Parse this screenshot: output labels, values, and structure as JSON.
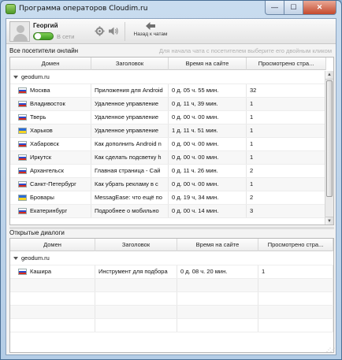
{
  "window": {
    "title": "Программа операторов Cloudim.ru",
    "minimize": "—",
    "maximize": "☐",
    "close": "✕"
  },
  "toolbar": {
    "operator_name": "Георгий",
    "status": "В сети",
    "back_label": "Назад к чатам"
  },
  "visitors": {
    "header": "Все посетители онлайн",
    "hint": "Для начала чата с посетителем выберите его двойным кликом",
    "columns": [
      "Домен",
      "Заголовок",
      "Время на сайте",
      "Просмотрено стра..."
    ],
    "group": "geodum.ru",
    "rows": [
      {
        "flag": "ru",
        "city": "Москва",
        "title": "Приложения для Android",
        "time": "0 д. 05 ч. 55 мин.",
        "views": "32"
      },
      {
        "flag": "ru",
        "city": "Владивосток",
        "title": "Удаленное управление",
        "time": "0 д. 11 ч, 39 мин.",
        "views": "1"
      },
      {
        "flag": "ru",
        "city": "Тверь",
        "title": "Удаленное управление",
        "time": "0 д. 00 ч. 00 мин.",
        "views": "1"
      },
      {
        "flag": "ua",
        "city": "Харьков",
        "title": "Удаленное управление",
        "time": "1 д. 11 ч. 51 мин.",
        "views": "1"
      },
      {
        "flag": "ru",
        "city": "Хабаровск",
        "title": "Как дополнить Android n",
        "time": "0 д. 00 ч. 00 мин.",
        "views": "1"
      },
      {
        "flag": "ru",
        "city": "Иркутск",
        "title": "Как сделать подсветку h",
        "time": "0 д. 00 ч. 00 мин.",
        "views": "1"
      },
      {
        "flag": "ru",
        "city": "Архангельск",
        "title": "Главная страница - Сай",
        "time": "0 д. 11 ч. 26 мин.",
        "views": "2"
      },
      {
        "flag": "ru",
        "city": "Санкт-Петербург",
        "title": "Как убрать рекламу в с",
        "time": "0 д. 00 ч. 00 мин.",
        "views": "1"
      },
      {
        "flag": "ua",
        "city": "Бровары",
        "title": "MessagEase: что ещё по",
        "time": "0 д. 19 ч, 34 мин.",
        "views": "2"
      },
      {
        "flag": "ru",
        "city": "Екатеринбург",
        "title": "Подробнее о мобильно",
        "time": "0 д. 00 ч. 14 мин.",
        "views": "3"
      }
    ]
  },
  "dialogs": {
    "header": "Открытые диалоги",
    "columns": [
      "Домен",
      "Заголовок",
      "Время на сайте",
      "Просмотрено стра..."
    ],
    "group": "geodum.ru",
    "rows": [
      {
        "flag": "ru",
        "city": "Кашира",
        "title": "Инструмент для подбора",
        "time": "0 д. 08 ч. 20 мин.",
        "views": "1"
      }
    ]
  },
  "icons": [
    "app-icon",
    "avatar",
    "settings-icon",
    "sound-icon",
    "back-arrow-icon",
    "expand-triangle-icon",
    "russia-flag-icon",
    "ukraine-flag-icon"
  ],
  "colors": {
    "status_green": "#3e9a20",
    "close_red": "#c4492d",
    "hint_gray": "#b0b0b0"
  }
}
